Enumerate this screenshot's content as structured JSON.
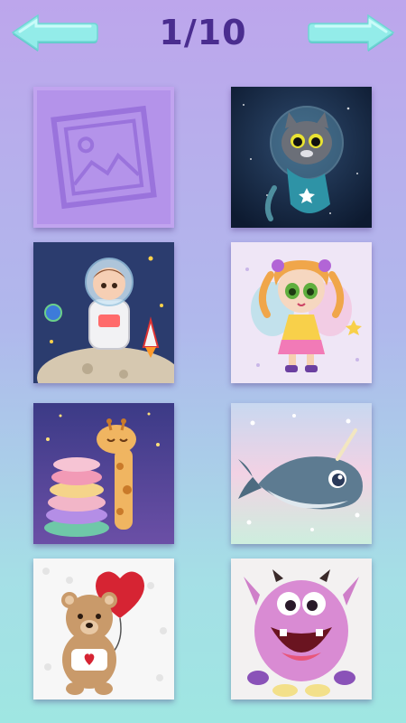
{
  "header": {
    "page_counter": "1/10",
    "prev_icon": "arrow-left-icon",
    "next_icon": "arrow-right-icon"
  },
  "colors": {
    "accent": "#4a2d8f",
    "button": "#8fe9e6",
    "placeholder": "#b79ae6"
  },
  "gallery": {
    "tiles": [
      {
        "subject": "placeholder",
        "icon": "image-placeholder-icon"
      },
      {
        "subject": "cat-astronaut"
      },
      {
        "subject": "boy-astronaut"
      },
      {
        "subject": "fairy-girl"
      },
      {
        "subject": "giraffe-pillows"
      },
      {
        "subject": "narwhal-whale"
      },
      {
        "subject": "teddy-bear-heart"
      },
      {
        "subject": "pink-monster"
      }
    ]
  }
}
